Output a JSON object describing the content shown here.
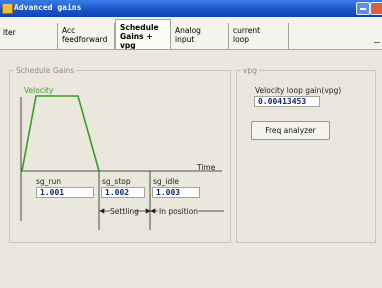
{
  "window": {
    "title": "Advanced gains"
  },
  "tabs": [
    {
      "label": "lter"
    },
    {
      "label": "Acc\nfeedforward"
    },
    {
      "label": "Schedule\nGains + vpg"
    },
    {
      "label": "Analog\ninput"
    },
    {
      "label": "current\nloop"
    }
  ],
  "schedule_gains": {
    "group_label": "Schedule Gains",
    "velocity_label": "Velocity",
    "time_label": "Time",
    "fields": [
      {
        "label": "sg_run",
        "value": "1.001"
      },
      {
        "label": "sg_stop",
        "value": "1.002"
      },
      {
        "label": "sg_idle",
        "value": "1.003"
      }
    ],
    "settling_label": "Settling",
    "in_position_label": "In position"
  },
  "vpg": {
    "group_label": "vpg",
    "loop_gain_label": "Velocity loop gain(vpg)",
    "loop_gain_value": "0.00413453",
    "analyzer_button": "Freq analyzer"
  },
  "colors": {
    "velocity_curve": "#3a9a28",
    "title_bar": "#1a52c8"
  }
}
